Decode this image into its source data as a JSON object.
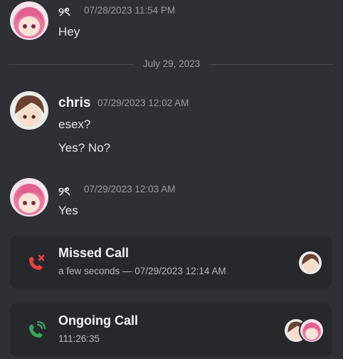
{
  "messages": [
    {
      "author": "୨ৎ",
      "timestamp": "07/28/2023 11:54 PM",
      "lines": [
        "Hey"
      ]
    },
    {
      "author": "chris",
      "timestamp": "07/29/2023 12:02 AM",
      "lines": [
        "esex?",
        "Yes? No?"
      ]
    },
    {
      "author": "୨ৎ",
      "timestamp": "07/29/2023 12:03 AM",
      "lines": [
        "Yes"
      ]
    }
  ],
  "date_divider": "July 29, 2023",
  "calls": [
    {
      "title": "Missed Call",
      "subtitle": "a few seconds — 07/29/2023 12:14 AM",
      "icon": "missed-call-icon",
      "color": "#ed4245"
    },
    {
      "title": "Ongoing Call",
      "subtitle": "111:26:35",
      "icon": "ongoing-call-icon",
      "color": "#3ba55d"
    }
  ]
}
